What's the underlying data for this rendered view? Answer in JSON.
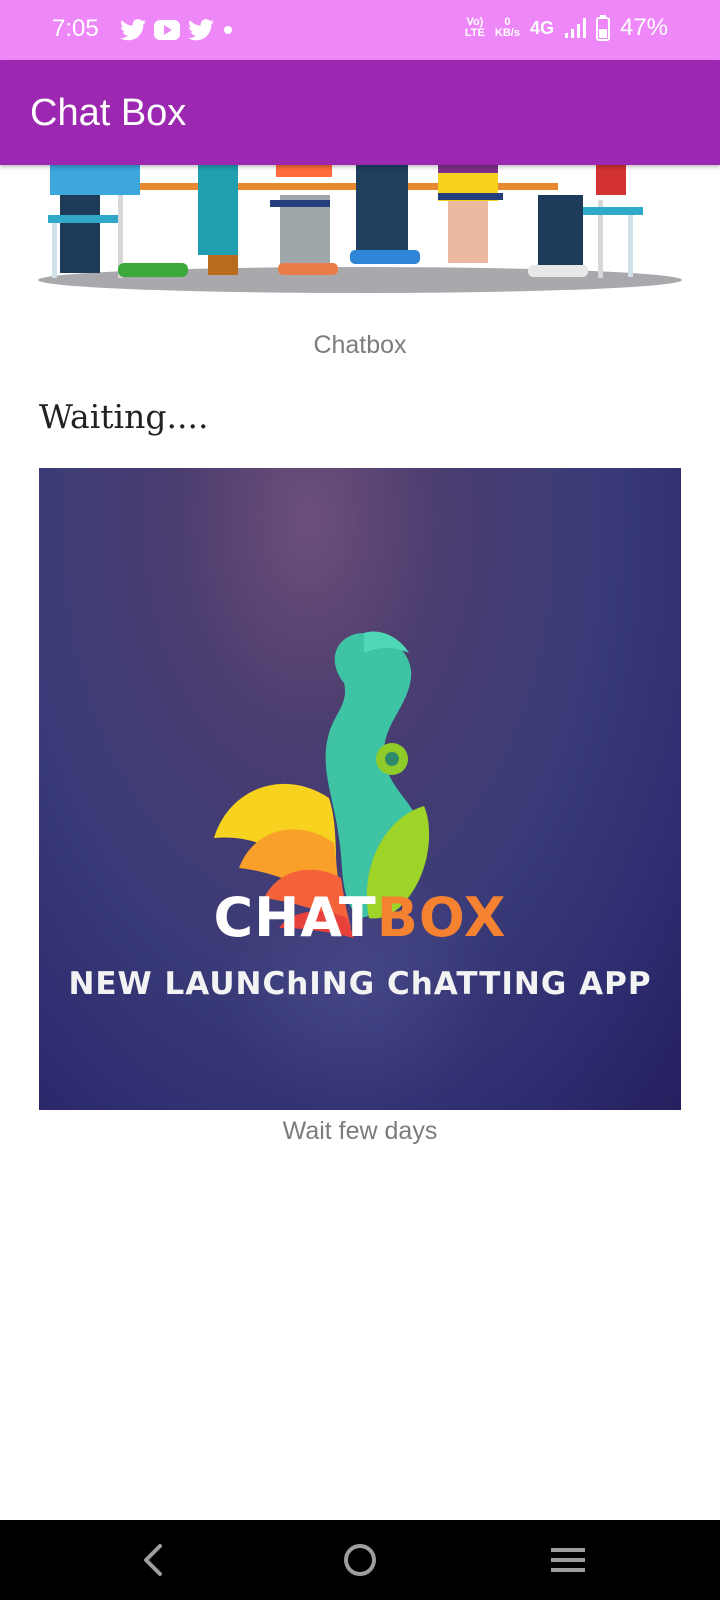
{
  "status_bar": {
    "time": "7:05",
    "left_icons": [
      "twitter-icon",
      "youtube-icon",
      "twitter-icon",
      "dot-icon"
    ],
    "volte_line1": "Vo)",
    "volte_line2": "LTE",
    "speed_value": "0",
    "speed_unit": "KB/s",
    "network": "4G",
    "battery": "47%",
    "color": "#ee88f8"
  },
  "app_bar": {
    "title": "Chat Box",
    "color": "#9c27b0"
  },
  "content": {
    "image1_caption": "Chatbox",
    "heading": "Waiting....",
    "poster": {
      "brand_part1": "CHAT",
      "brand_part2": "BOX",
      "tagline": "NEW LAUNChING ChATTING APP"
    },
    "image2_caption": "Wait few days"
  },
  "nav_bar": {
    "buttons": [
      "back-icon",
      "home-icon",
      "recents-icon"
    ]
  }
}
